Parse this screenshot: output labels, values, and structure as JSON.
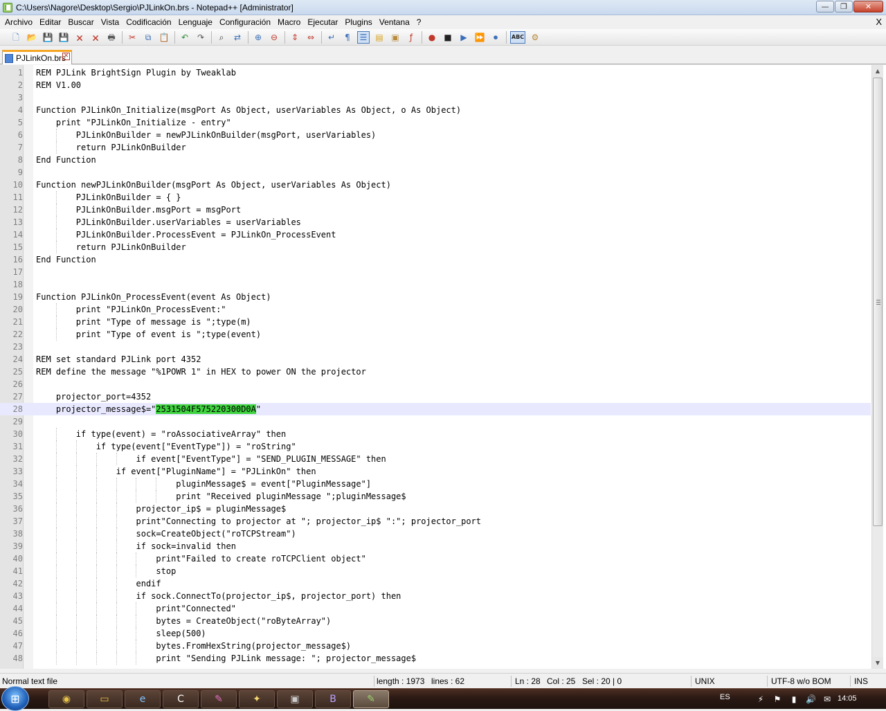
{
  "window": {
    "title": "C:\\Users\\Nagore\\Desktop\\Sergio\\PJLinkOn.brs - Notepad++ [Administrator]",
    "minimize": "—",
    "maximize": "❐",
    "close": "✕"
  },
  "menu": {
    "items": [
      "Archivo",
      "Editar",
      "Buscar",
      "Vista",
      "Codificación",
      "Lenguaje",
      "Configuración",
      "Macro",
      "Ejecutar",
      "Plugins",
      "Ventana",
      "?"
    ],
    "close": "X"
  },
  "toolbar": {
    "buttons": [
      {
        "name": "new-file-icon",
        "glyph": "🗋",
        "color": "#4a7fc1"
      },
      {
        "name": "open-file-icon",
        "glyph": "📂",
        "color": "#d9a520"
      },
      {
        "name": "save-icon",
        "glyph": "💾",
        "color": "#4a6fa5"
      },
      {
        "name": "save-all-icon",
        "glyph": "💾",
        "color": "#4a6fa5"
      },
      {
        "name": "close-file-icon",
        "glyph": "🗙",
        "color": "#c0392b"
      },
      {
        "name": "close-all-icon",
        "glyph": "🗙",
        "color": "#c0392b"
      },
      {
        "name": "print-icon",
        "glyph": "🖶",
        "color": "#555555"
      },
      {
        "sep": true
      },
      {
        "name": "cut-icon",
        "glyph": "✂",
        "color": "#c0392b"
      },
      {
        "name": "copy-icon",
        "glyph": "⧉",
        "color": "#3a6fb8"
      },
      {
        "name": "paste-icon",
        "glyph": "📋",
        "color": "#b88a3a"
      },
      {
        "sep": true
      },
      {
        "name": "undo-icon",
        "glyph": "↶",
        "color": "#2e8b3a"
      },
      {
        "name": "redo-icon",
        "glyph": "↷",
        "color": "#555555"
      },
      {
        "sep": true
      },
      {
        "name": "find-icon",
        "glyph": "⌕",
        "color": "#333333"
      },
      {
        "name": "replace-icon",
        "glyph": "⇄",
        "color": "#3a6fb8"
      },
      {
        "sep": true
      },
      {
        "name": "zoom-in-icon",
        "glyph": "⊕",
        "color": "#3a6fb8"
      },
      {
        "name": "zoom-out-icon",
        "glyph": "⊖",
        "color": "#c0392b"
      },
      {
        "sep": true
      },
      {
        "name": "sync-vertical-icon",
        "glyph": "⇕",
        "color": "#c0392b"
      },
      {
        "name": "sync-horizontal-icon",
        "glyph": "⇔",
        "color": "#c0392b"
      },
      {
        "sep": true
      },
      {
        "name": "word-wrap-icon",
        "glyph": "↵",
        "color": "#3a6fb8"
      },
      {
        "name": "show-all-chars-icon",
        "glyph": "¶",
        "color": "#3a6fb8"
      },
      {
        "name": "indent-guide-icon",
        "glyph": "☰",
        "color": "#3a6fb8",
        "active": true
      },
      {
        "name": "user-language-icon",
        "glyph": "▤",
        "color": "#d9a520"
      },
      {
        "name": "doc-map-icon",
        "glyph": "▣",
        "color": "#b88a3a"
      },
      {
        "name": "function-list-icon",
        "glyph": "ƒ",
        "color": "#c0392b"
      },
      {
        "sep": true
      },
      {
        "name": "record-macro-icon",
        "glyph": "●",
        "color": "#c0392b"
      },
      {
        "name": "stop-macro-icon",
        "glyph": "■",
        "color": "#222222"
      },
      {
        "name": "play-macro-icon",
        "glyph": "▶",
        "color": "#3a6fb8"
      },
      {
        "name": "run-macro-multiple-icon",
        "glyph": "⏩",
        "color": "#3a6fb8"
      },
      {
        "name": "save-macro-icon",
        "glyph": "⏺",
        "color": "#3a6fb8"
      },
      {
        "sep": true
      },
      {
        "name": "spell-check-icon",
        "glyph": "ABC",
        "color": "#222222",
        "active": true
      },
      {
        "name": "plugin-icon",
        "glyph": "⚙",
        "color": "#b88a3a"
      }
    ]
  },
  "tab": {
    "label": "PJLinkOn.brs",
    "close": "✕"
  },
  "editor": {
    "lines": [
      {
        "n": "1",
        "text": "REM PJLink BrightSign Plugin by Tweaklab",
        "guides": []
      },
      {
        "n": "2",
        "text": "REM V1.00",
        "guides": []
      },
      {
        "n": "3",
        "text": "",
        "guides": []
      },
      {
        "n": "4",
        "text": "Function PJLinkOn_Initialize(msgPort As Object, userVariables As Object, o As Object)",
        "guides": []
      },
      {
        "n": "5",
        "text": "    print \"PJLinkOn_Initialize - entry\"",
        "guides": []
      },
      {
        "n": "6",
        "text": "        PJLinkOnBuilder = newPJLinkOnBuilder(msgPort, userVariables)",
        "guides": [
          4
        ]
      },
      {
        "n": "7",
        "text": "        return PJLinkOnBuilder",
        "guides": [
          4
        ]
      },
      {
        "n": "8",
        "text": "End Function",
        "guides": []
      },
      {
        "n": "9",
        "text": "",
        "guides": []
      },
      {
        "n": "10",
        "text": "Function newPJLinkOnBuilder(msgPort As Object, userVariables As Object)",
        "guides": []
      },
      {
        "n": "11",
        "text": "        PJLinkOnBuilder = { }",
        "guides": [
          4
        ]
      },
      {
        "n": "12",
        "text": "        PJLinkOnBuilder.msgPort = msgPort",
        "guides": [
          4
        ]
      },
      {
        "n": "13",
        "text": "        PJLinkOnBuilder.userVariables = userVariables",
        "guides": [
          4
        ]
      },
      {
        "n": "14",
        "text": "        PJLinkOnBuilder.ProcessEvent = PJLinkOn_ProcessEvent",
        "guides": [
          4
        ]
      },
      {
        "n": "15",
        "text": "        return PJLinkOnBuilder",
        "guides": [
          4
        ]
      },
      {
        "n": "16",
        "text": "End Function",
        "guides": []
      },
      {
        "n": "17",
        "text": "",
        "guides": []
      },
      {
        "n": "18",
        "text": "",
        "guides": []
      },
      {
        "n": "19",
        "text": "Function PJLinkOn_ProcessEvent(event As Object)",
        "guides": []
      },
      {
        "n": "20",
        "text": "        print \"PJLinkOn_ProcessEvent:\"",
        "guides": [
          4
        ]
      },
      {
        "n": "21",
        "text": "        print \"Type of message is \";type(m)",
        "guides": [
          4
        ]
      },
      {
        "n": "22",
        "text": "        print \"Type of event is \";type(event)",
        "guides": [
          4
        ]
      },
      {
        "n": "23",
        "text": "",
        "guides": []
      },
      {
        "n": "24",
        "text": "REM set standard PJLink port 4352",
        "guides": []
      },
      {
        "n": "25",
        "text": "REM define the message \"%1POWR 1\" in HEX to power ON the projector",
        "guides": []
      },
      {
        "n": "26",
        "text": "",
        "guides": []
      },
      {
        "n": "27",
        "text": "    projector_port=4352",
        "guides": []
      },
      {
        "n": "28",
        "pre": "    projector_message$=\"",
        "hl": "2531504F575220300D0A",
        "post": "\"",
        "current": true,
        "guides": []
      },
      {
        "n": "29",
        "text": "",
        "guides": []
      },
      {
        "n": "30",
        "text": "        if type(event) = \"roAssociativeArray\" then",
        "guides": [
          4
        ]
      },
      {
        "n": "31",
        "text": "            if type(event[\"EventType\"]) = \"roString\"",
        "guides": [
          4,
          8
        ]
      },
      {
        "n": "32",
        "text": "                    if event[\"EventType\"] = \"SEND_PLUGIN_MESSAGE\" then",
        "guides": [
          4,
          8,
          12,
          16
        ]
      },
      {
        "n": "33",
        "text": "                if event[\"PluginName\"] = \"PJLinkOn\" then",
        "guides": [
          4,
          8,
          12
        ]
      },
      {
        "n": "34",
        "text": "                            pluginMessage$ = event[\"PluginMessage\"]",
        "guides": [
          4,
          8,
          12,
          16,
          20,
          24
        ]
      },
      {
        "n": "35",
        "text": "                            print \"Received pluginMessage \";pluginMessage$",
        "guides": [
          4,
          8,
          12,
          16,
          20,
          24
        ]
      },
      {
        "n": "36",
        "text": "                    projector_ip$ = pluginMessage$",
        "guides": [
          4,
          8,
          12,
          16
        ]
      },
      {
        "n": "37",
        "text": "                    print\"Connecting to projector at \"; projector_ip$ \":\"; projector_port",
        "guides": [
          4,
          8,
          12,
          16
        ]
      },
      {
        "n": "38",
        "text": "                    sock=CreateObject(\"roTCPStream\")",
        "guides": [
          4,
          8,
          12,
          16
        ]
      },
      {
        "n": "39",
        "text": "                    if sock=invalid then",
        "guides": [
          4,
          8,
          12,
          16
        ]
      },
      {
        "n": "40",
        "text": "                        print\"Failed to create roTCPClient object\"",
        "guides": [
          4,
          8,
          12,
          16,
          20
        ]
      },
      {
        "n": "41",
        "text": "                        stop",
        "guides": [
          4,
          8,
          12,
          16,
          20
        ]
      },
      {
        "n": "42",
        "text": "                    endif",
        "guides": [
          4,
          8,
          12,
          16
        ]
      },
      {
        "n": "43",
        "text": "                    if sock.ConnectTo(projector_ip$, projector_port) then",
        "guides": [
          4,
          8,
          12,
          16
        ]
      },
      {
        "n": "44",
        "text": "                        print\"Connected\"",
        "guides": [
          4,
          8,
          12,
          16,
          20
        ]
      },
      {
        "n": "45",
        "text": "                        bytes = CreateObject(\"roByteArray\")",
        "guides": [
          4,
          8,
          12,
          16,
          20
        ]
      },
      {
        "n": "46",
        "text": "                        sleep(500)",
        "guides": [
          4,
          8,
          12,
          16,
          20
        ]
      },
      {
        "n": "47",
        "text": "                        bytes.FromHexString(projector_message$)",
        "guides": [
          4,
          8,
          12,
          16,
          20
        ]
      },
      {
        "n": "48",
        "text": "                        print \"Sending PJLink message: \"; projector_message$",
        "guides": [
          4,
          8,
          12,
          16,
          20
        ]
      }
    ]
  },
  "scrollbar": {
    "up": "▲",
    "down": "▼"
  },
  "status": {
    "filetype": "Normal text file",
    "length": "length : 1973",
    "lines": "lines : 62",
    "ln": "Ln : 28",
    "col": "Col : 25",
    "sel": "Sel : 20 | 0",
    "eol": "UNIX",
    "encoding": "UTF-8 w/o BOM",
    "mode": "INS"
  },
  "taskbar": {
    "start": "⊞",
    "apps": [
      {
        "name": "chrome-taskbar-icon",
        "glyph": "◉",
        "color": "#e8c34a"
      },
      {
        "name": "explorer-taskbar-icon",
        "glyph": "▭",
        "color": "#e8c34a"
      },
      {
        "name": "ie-taskbar-icon",
        "glyph": "e",
        "color": "#7fc3ff"
      },
      {
        "name": "app-c-taskbar-icon",
        "glyph": "C",
        "color": "#ffffff"
      },
      {
        "name": "app-pen-taskbar-icon",
        "glyph": "✎",
        "color": "#e070c0"
      },
      {
        "name": "app-star-taskbar-icon",
        "glyph": "✦",
        "color": "#f5d76e"
      },
      {
        "name": "cmd-taskbar-icon",
        "glyph": "▣",
        "color": "#cccccc"
      },
      {
        "name": "app-ba-taskbar-icon",
        "glyph": "B",
        "color": "#b9a3ff"
      },
      {
        "name": "notepadpp-taskbar-icon",
        "glyph": "✎",
        "color": "#9bd16a",
        "active": true
      }
    ],
    "lang": "ES",
    "tray": [
      "⚡",
      "⚑",
      "▮",
      "🔊",
      "✉"
    ],
    "clock": "14:05"
  }
}
